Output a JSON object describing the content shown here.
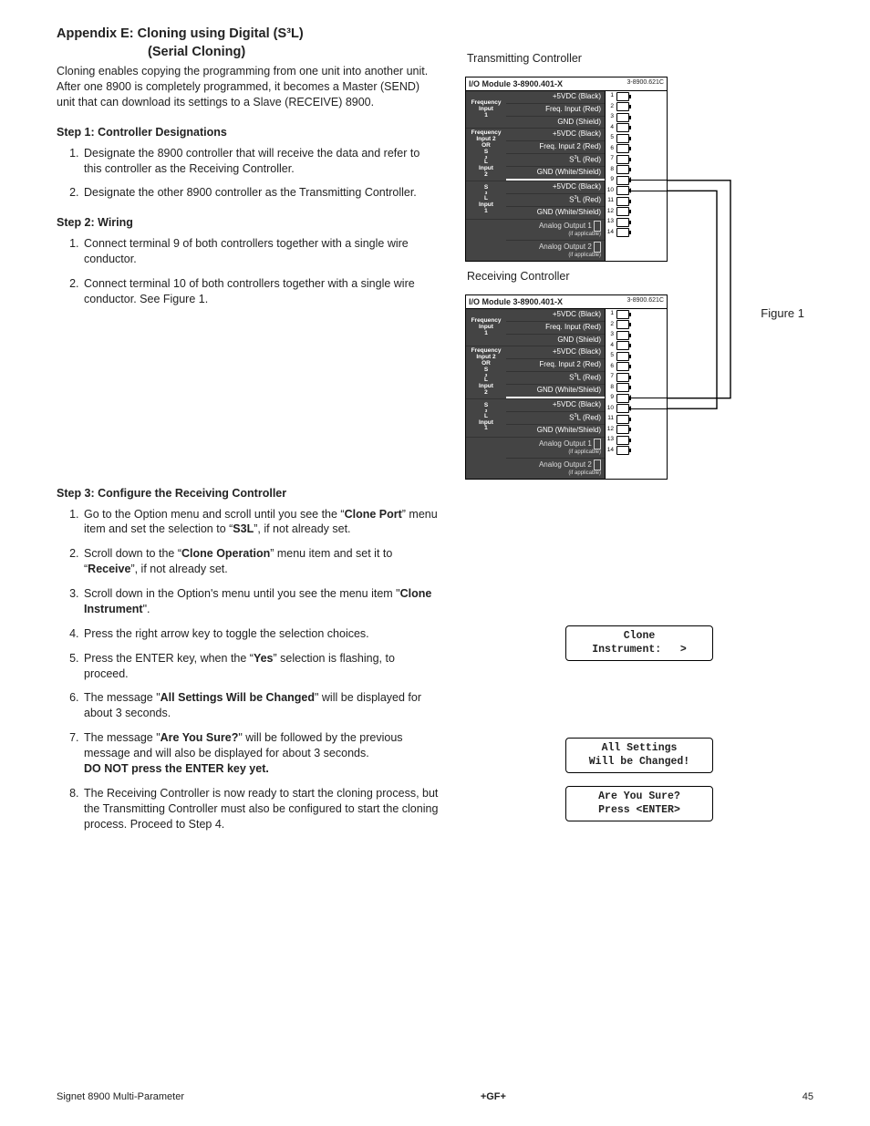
{
  "heading_main": "Appendix E:  Cloning using Digital (S³L)",
  "heading_sub": "(Serial Cloning)",
  "intro": "Cloning enables copying the programming from one unit into another unit.  After one 8900 is completely programmed, it becomes a Master (SEND) unit that can download its settings to a Slave (RECEIVE) 8900.",
  "step1_title": "Step 1: Controller Designations",
  "step1_items": [
    "Designate the 8900 controller that will receive the data and refer to this controller as the Receiving Controller.",
    "Designate the other 8900 controller as the Transmitting Controller."
  ],
  "step2_title": "Step 2: Wiring",
  "step2_items": [
    "Connect terminal 9 of both controllers together with a single wire conductor.",
    "Connect terminal 10 of both controllers together with a single wire conductor. See Figure 1."
  ],
  "step3_title": "Step 3: Configure the Receiving Controller",
  "step3_items": [
    {
      "pre": "Go to the Option menu and scroll until you see the “",
      "b1": "Clone Port",
      "mid1": "” menu item and set the selection to “",
      "b2": "S3L",
      "post": "”, if not already set."
    },
    {
      "pre": "Scroll down to the “",
      "b1": "Clone Operation",
      "mid1": "” menu item and set it to “",
      "b2": "Receive",
      "post": "”, if not already set."
    },
    {
      "pre": "Scroll down in the Option's menu until you see the menu item \"",
      "b1": "Clone Instrument",
      "post": "\"."
    },
    {
      "plain": "Press the right arrow key to toggle the selection choices."
    },
    {
      "pre": "Press the ENTER key, when the “",
      "b1": "Yes",
      "post": "” selection is flashing, to proceed."
    },
    {
      "pre": "The message \"",
      "b1": "All Settings Will be Changed",
      "post": "\" will be displayed for about 3 seconds."
    },
    {
      "pre": "The message \"",
      "b1": "Are You Sure?",
      "post": "\" will be followed by the previous message and will also be displayed for about 3 seconds.",
      "tail_bold": "DO NOT press the ENTER key yet."
    },
    {
      "plain": "The Receiving Controller is now ready to start the cloning process, but the Transmitting Controller must also be configured to start the cloning process. Proceed to Step 4."
    }
  ],
  "tx_title": "Transmitting Controller",
  "rx_title": "Receiving Controller",
  "figure_label": "Figure 1",
  "module_header": "I/O Module 3-8900.401-X",
  "module_code": "3-8900.621C",
  "groups": [
    {
      "label": "Frequency\nInput\n1",
      "signals": [
        "+5VDC (Black)",
        "Freq. Input (Red)",
        "GND (Shield)"
      ]
    },
    {
      "label": "Frequency\nInput 2\nOR\nS³L\nInput\n2",
      "signals": [
        "+5VDC (Black)",
        "Freq. Input 2 (Red)",
        "S³L (Red)",
        "GND (White/Shield)"
      ]
    },
    {
      "label": "S³L\nInput\n1",
      "signals": [
        "+5VDC (Black)",
        "S³L (Red)",
        "GND (White/Shield)"
      ]
    },
    {
      "label": "",
      "signals_analog": [
        {
          "name": "Analog Output 1",
          "note": "(if applicable)"
        },
        {
          "name": "Analog Output 2",
          "note": "(if applicable)"
        }
      ]
    }
  ],
  "lcd1_line1": "Clone",
  "lcd1_line2": "Instrument:   >",
  "lcd2_line1": "All Settings",
  "lcd2_line2": "Will be Changed!",
  "lcd3_line1": "Are You Sure?",
  "lcd3_line2": "Press <ENTER>",
  "footer_left": "Signet 8900 Multi-Parameter",
  "footer_center": "+GF+",
  "footer_right": "45"
}
